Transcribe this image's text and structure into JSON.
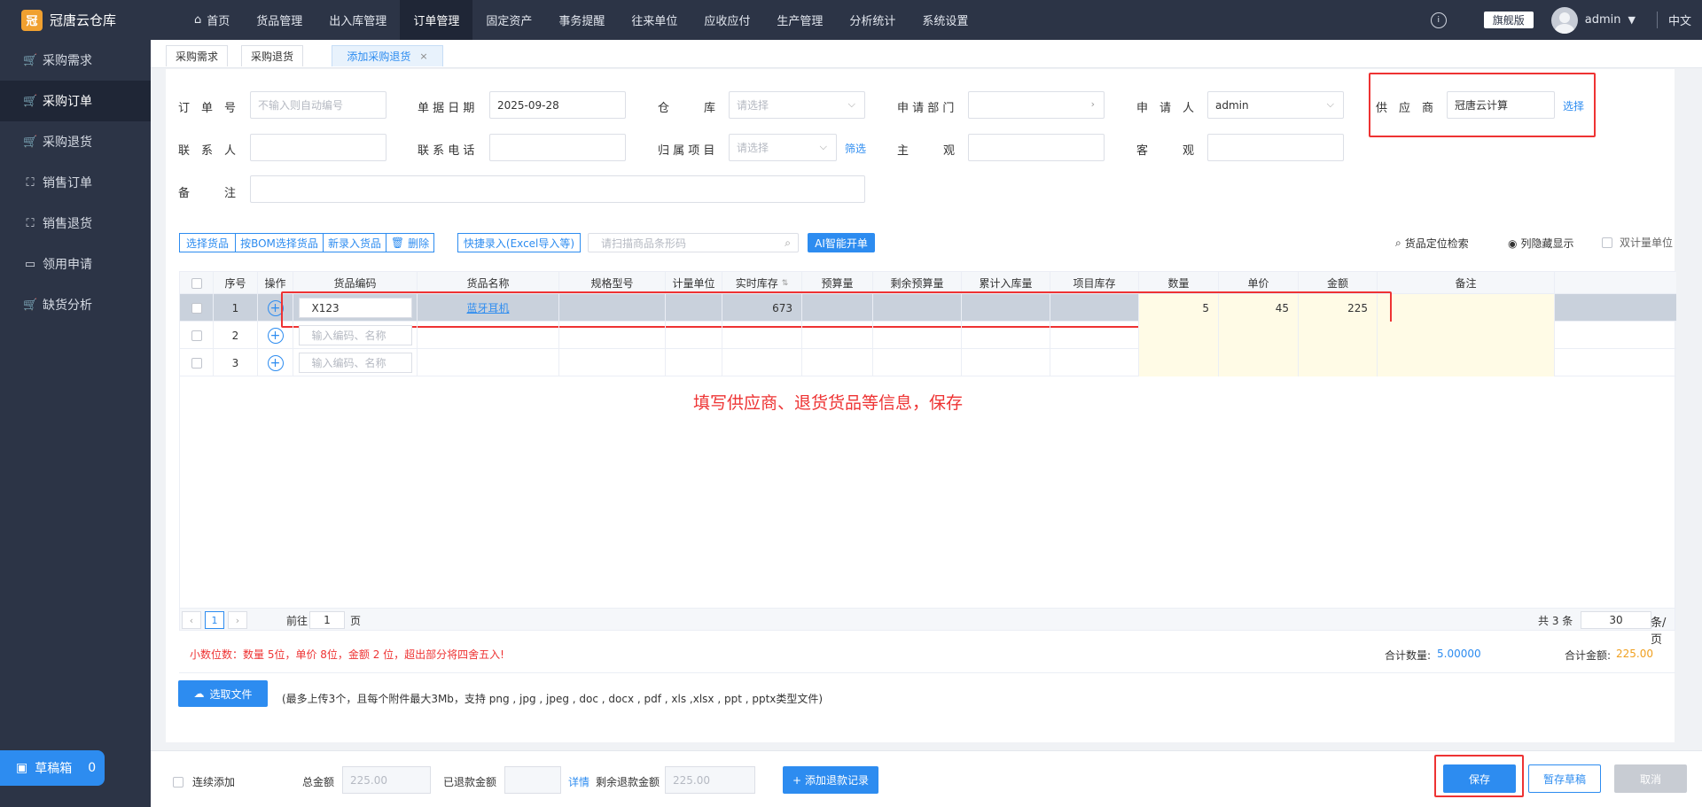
{
  "app": {
    "name": "冠唐云仓库",
    "logo_glyph": "冠"
  },
  "sidebar": {
    "items": [
      {
        "label": "采购需求",
        "icon": "cart-icon"
      },
      {
        "label": "采购订单",
        "icon": "cart-icon"
      },
      {
        "label": "采购退货",
        "icon": "cart-icon"
      },
      {
        "label": "销售订单",
        "icon": "bag-icon"
      },
      {
        "label": "销售退货",
        "icon": "bag-icon"
      },
      {
        "label": "领用申请",
        "icon": "box-icon"
      },
      {
        "label": "缺货分析",
        "icon": "cart-icon"
      }
    ],
    "active_index": 1,
    "draft": {
      "label": "草稿箱",
      "count": "0"
    }
  },
  "topnav": {
    "items": [
      "首页",
      "货品管理",
      "出入库管理",
      "订单管理",
      "固定资产",
      "事务提醒",
      "往来单位",
      "应收应付",
      "生产管理",
      "分析统计",
      "系统设置"
    ],
    "active_index": 3,
    "badge": "旗舰版",
    "user": "admin",
    "lang": "中文"
  },
  "tabs": [
    {
      "label": "采购需求"
    },
    {
      "label": "采购退货"
    },
    {
      "label": "添加采购退货",
      "close": "×"
    }
  ],
  "form": {
    "order_no": {
      "label": "订　单　号",
      "placeholder": "不输入则自动编号"
    },
    "date": {
      "label": "单 据 日 期",
      "value": "2025-09-28"
    },
    "warehouse": {
      "label": "仓　　　库",
      "placeholder": "请选择"
    },
    "dept": {
      "label": "申 请 部 门",
      "value": ""
    },
    "applicant": {
      "label": "申　请　人",
      "value": "admin"
    },
    "supplier": {
      "label": "供　应　商",
      "value": "冠唐云计算",
      "link": "选择"
    },
    "contact": {
      "label": "联　系　人",
      "value": ""
    },
    "phone": {
      "label": "联 系 电 话",
      "value": ""
    },
    "project": {
      "label": "归 属 项 目",
      "placeholder": "请选择",
      "link": "筛选"
    },
    "subjective": {
      "label": "主　　　观",
      "value": ""
    },
    "objective": {
      "label": "客　　　观",
      "value": ""
    },
    "remark": {
      "label": "备　　　注",
      "value": ""
    }
  },
  "toolbar": {
    "select_goods": "选择货品",
    "bom_select": "按BOM选择货品",
    "new_goods": "新录入货品",
    "delete": "删除",
    "quick_entry": "快捷录入(Excel导入等)",
    "scan_placeholder": "请扫描商品条形码",
    "ai_btn": "AI智能开单",
    "locate": "货品定位检索",
    "columns": "列隐藏显示",
    "dual_unit": "双计量单位"
  },
  "table": {
    "headers": [
      "序号",
      "操作",
      "货品编码",
      "货品名称",
      "规格型号",
      "计量单位",
      "实时库存",
      "预算量",
      "剩余预算量",
      "累计入库量",
      "项目库存",
      "数量",
      "单价",
      "金额",
      "备注"
    ],
    "rows": [
      {
        "no": "1",
        "code": "X123",
        "name": "蓝牙耳机",
        "stock": "673",
        "qty": "5",
        "price": "45",
        "amount": "225"
      },
      {
        "no": "2",
        "code_placeholder": "输入编码、名称"
      },
      {
        "no": "3",
        "code_placeholder": "输入编码、名称"
      }
    ],
    "annotation": "填写供应商、退货货品等信息，保存"
  },
  "pager": {
    "current": "1",
    "goto_prefix": "前往",
    "goto_value": "1",
    "goto_suffix": "页",
    "total": "共 3 条",
    "page_size": "30",
    "page_size_suffix": "条/页"
  },
  "summary": {
    "decimal_note": "小数位数：数量 5位，单价 8位，金额 2 位，超出部分将四舍五入!",
    "total_qty_label": "合计数量:",
    "total_qty": "5.00000",
    "total_amount_label": "合计金额:",
    "total_amount": "225.00"
  },
  "upload": {
    "button": "选取文件",
    "note": "(最多上传3个，且每个附件最大3Mb，支持 png , jpg , jpeg , doc , docx , pdf , xls ,xlsx , ppt , pptx类型文件)"
  },
  "bottom": {
    "continuous_add": "连续添加",
    "total_label": "总金额",
    "total_value": "225.00",
    "refunded_label": "已退款金额",
    "refunded_value": "",
    "detail_link": "详情",
    "remaining_label": "剩余退款金额",
    "remaining_value": "225.00",
    "add_refund": "添加退款记录",
    "save": "保存",
    "save_draft": "暂存草稿",
    "cancel": "取消"
  }
}
